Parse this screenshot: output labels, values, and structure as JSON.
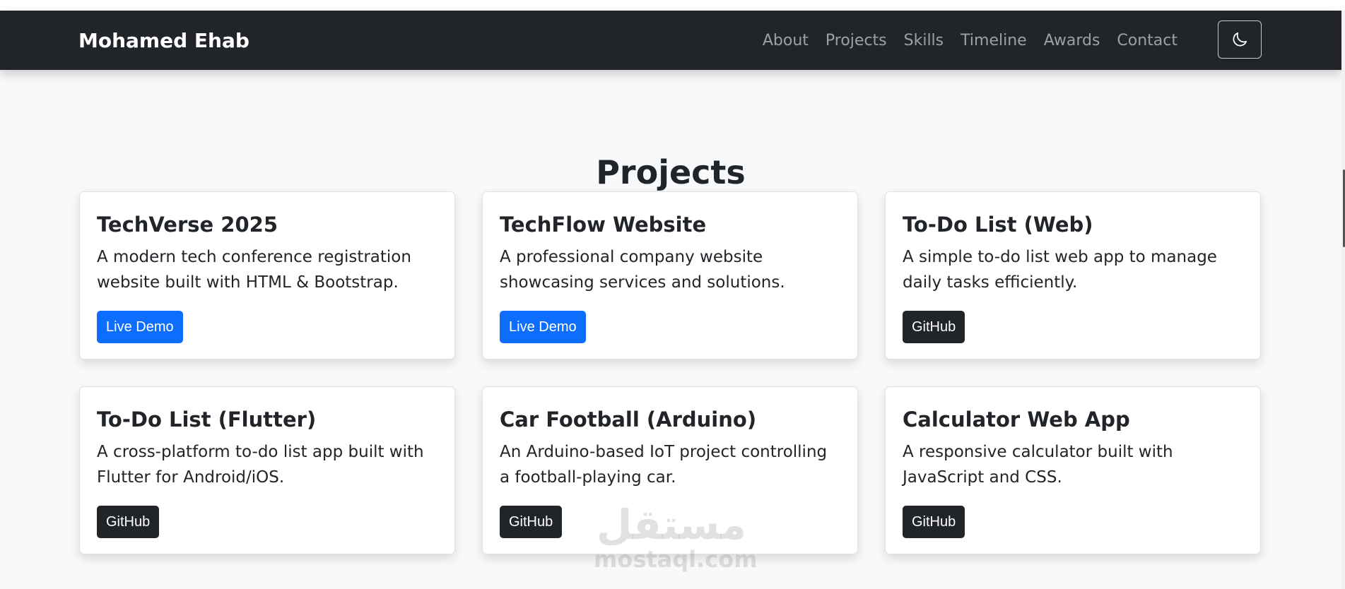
{
  "navbar": {
    "brand": "Mohamed Ehab",
    "links": [
      "About",
      "Projects",
      "Skills",
      "Timeline",
      "Awards",
      "Contact"
    ],
    "theme_toggle_icon": "moon-icon"
  },
  "section": {
    "title": "Projects"
  },
  "projects": [
    {
      "title": "TechVerse 2025",
      "description": "A modern tech conference registration website built with HTML & Bootstrap.",
      "button": "Live Demo",
      "button_style": "primary"
    },
    {
      "title": "TechFlow Website",
      "description": "A professional company website showcasing services and solutions.",
      "button": "Live Demo",
      "button_style": "primary"
    },
    {
      "title": "To-Do List (Web)",
      "description": "A simple to-do list web app to manage daily tasks efficiently.",
      "button": "GitHub",
      "button_style": "dark"
    },
    {
      "title": "To-Do List (Flutter)",
      "description": "A cross-platform to-do list app built with Flutter for Android/iOS.",
      "button": "GitHub",
      "button_style": "dark"
    },
    {
      "title": "Car Football (Arduino)",
      "description": "An Arduino-based IoT project controlling a football-playing car.",
      "button": "GitHub",
      "button_style": "dark"
    },
    {
      "title": "Calculator Web App",
      "description": "A responsive calculator built with JavaScript and CSS.",
      "button": "GitHub",
      "button_style": "dark"
    }
  ],
  "watermark": {
    "arabic": "مستقل",
    "latin": "mostaql.com"
  },
  "colors": {
    "navbar_bg": "#212529",
    "page_bg": "#f8f9fa",
    "primary": "#0d6efd",
    "dark": "#212529"
  }
}
